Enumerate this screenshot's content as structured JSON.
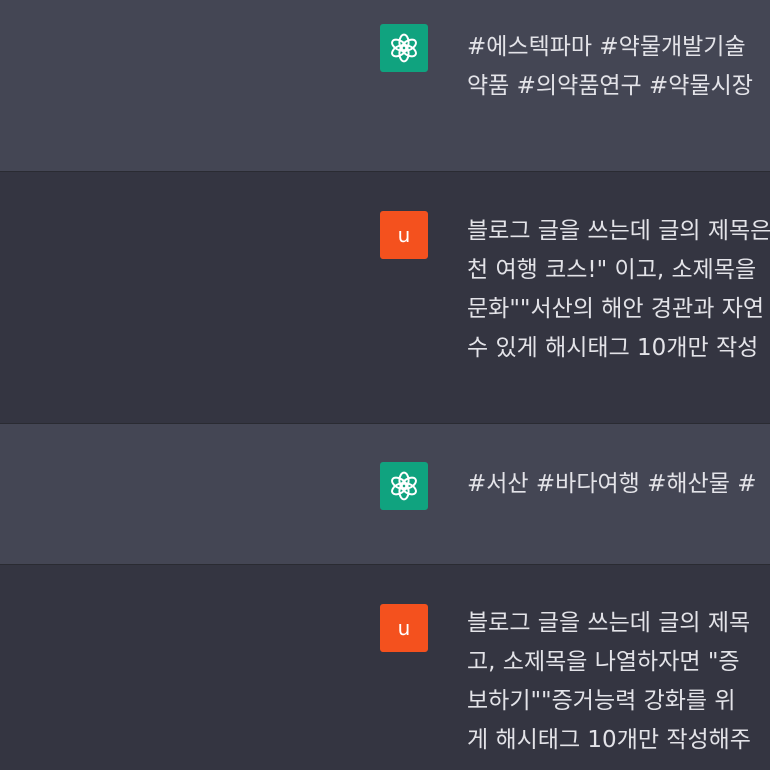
{
  "messages": [
    {
      "role": "assistant",
      "lines": [
        "#에스텍파마 #약물개발기술",
        "약품 #의약품연구 #약물시장"
      ]
    },
    {
      "role": "user",
      "avatar_letter": "u",
      "lines": [
        "블로그 글을 쓰는데 글의 제목은",
        "천 여행 코스!\" 이고, 소제목을",
        "문화\"\"서산의 해안 경관과 자연",
        "수 있게 해시태그 10개만 작성"
      ]
    },
    {
      "role": "assistant",
      "lines": [
        "#서산 #바다여행 #해산물 #"
      ]
    },
    {
      "role": "user",
      "avatar_letter": "u",
      "lines": [
        "블로그 글을 쓰는데 글의 제목",
        "고, 소제목을 나열하자면 \"증",
        "보하기\"\"증거능력 강화를 위",
        "게 해시태그 10개만 작성해주"
      ]
    }
  ],
  "colors": {
    "assistant_bg": "#444654",
    "user_bg": "#343541",
    "gpt_avatar": "#10a37f",
    "user_avatar": "#f4511e",
    "text": "#e3e3e8"
  },
  "icons": {
    "assistant_avatar": "openai-logo-icon"
  }
}
